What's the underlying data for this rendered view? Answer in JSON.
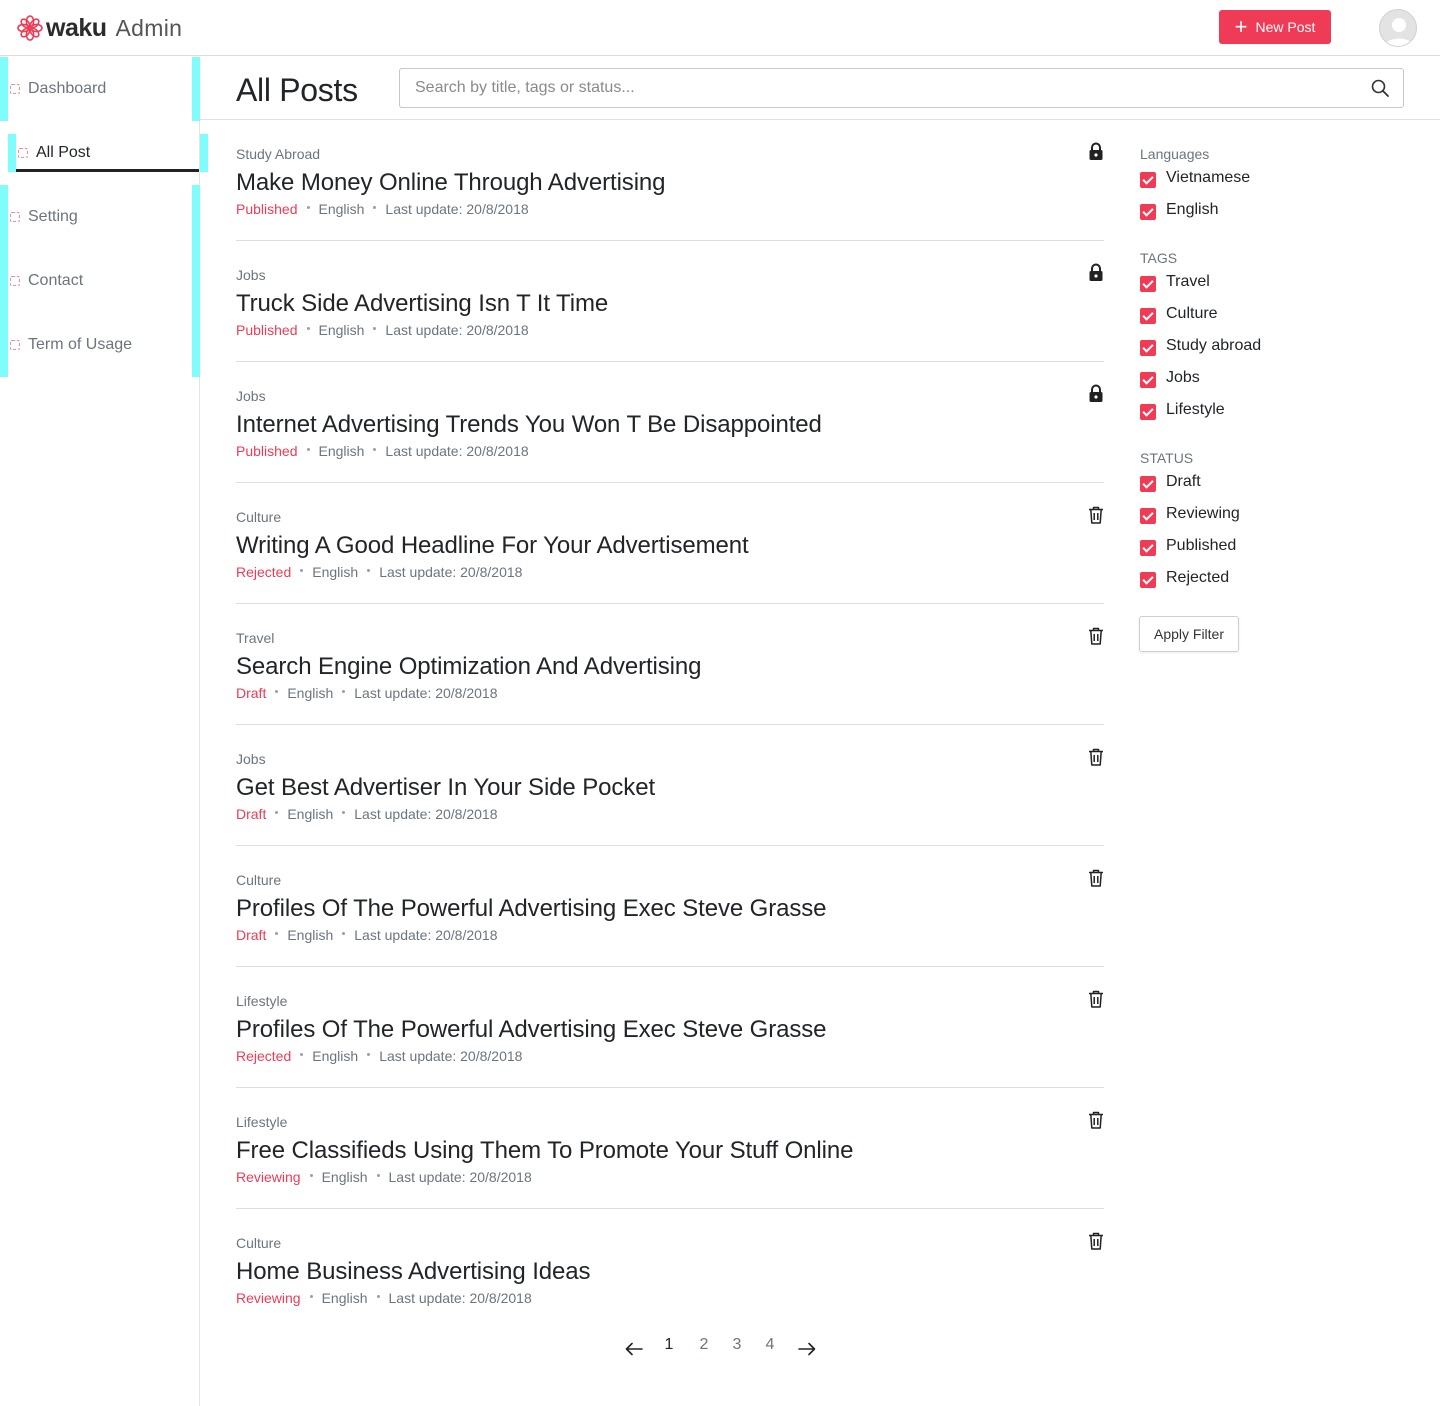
{
  "brand": {
    "name": "waku",
    "subtitle": "Admin"
  },
  "header": {
    "new_post_label": "New Post"
  },
  "sidebar": {
    "items": [
      {
        "label": "Dashboard"
      },
      {
        "label": "All Post"
      },
      {
        "label": "Setting"
      },
      {
        "label": "Contact"
      },
      {
        "label": "Term of Usage"
      }
    ]
  },
  "main": {
    "title": "All Posts",
    "search": {
      "placeholder": "Search by title, tags or status...",
      "value": ""
    }
  },
  "posts": [
    {
      "tag": "Study Abroad",
      "title": "Make Money Online Through Advertising",
      "status": "Published",
      "language": "English",
      "updated": "Last update: 20/8/2018",
      "action_icon": "lock-icon"
    },
    {
      "tag": "Jobs",
      "title": "Truck Side Advertising Isn T It Time",
      "status": "Published",
      "language": "English",
      "updated": "Last update: 20/8/2018",
      "action_icon": "lock-icon"
    },
    {
      "tag": "Jobs",
      "title": "Internet Advertising Trends You Won T Be Disappointed",
      "status": "Published",
      "language": "English",
      "updated": "Last update: 20/8/2018",
      "action_icon": "lock-icon"
    },
    {
      "tag": "Culture",
      "title": "Writing A Good Headline For Your Advertisement",
      "status": "Rejected",
      "language": "English",
      "updated": "Last update: 20/8/2018",
      "action_icon": "trash-icon"
    },
    {
      "tag": "Travel",
      "title": "Search Engine Optimization And Advertising",
      "status": "Draft",
      "language": "English",
      "updated": "Last update: 20/8/2018",
      "action_icon": "trash-icon"
    },
    {
      "tag": "Jobs",
      "title": "Get Best Advertiser In Your Side Pocket",
      "status": "Draft",
      "language": "English",
      "updated": "Last update: 20/8/2018",
      "action_icon": "trash-icon"
    },
    {
      "tag": "Culture",
      "title": "Profiles Of The Powerful Advertising Exec Steve Grasse",
      "status": "Draft",
      "language": "English",
      "updated": "Last update: 20/8/2018",
      "action_icon": "trash-icon"
    },
    {
      "tag": "Lifestyle",
      "title": "Profiles Of The Powerful Advertising Exec Steve Grasse",
      "status": "Rejected",
      "language": "English",
      "updated": "Last update: 20/8/2018",
      "action_icon": "trash-icon"
    },
    {
      "tag": "Lifestyle",
      "title": "Free Classifieds Using Them To Promote Your Stuff Online",
      "status": "Reviewing",
      "language": "English",
      "updated": "Last update: 20/8/2018",
      "action_icon": "trash-icon"
    },
    {
      "tag": "Culture",
      "title": "Home Business Advertising Ideas",
      "status": "Reviewing",
      "language": "English",
      "updated": "Last update: 20/8/2018",
      "action_icon": "trash-icon"
    }
  ],
  "filters": {
    "languages": {
      "heading": "Languages",
      "options": [
        {
          "label": "Vietnamese",
          "checked": true
        },
        {
          "label": "English",
          "checked": true
        }
      ]
    },
    "tags": {
      "heading": "TAGS",
      "options": [
        {
          "label": "Travel",
          "checked": true
        },
        {
          "label": "Culture",
          "checked": true
        },
        {
          "label": "Study abroad",
          "checked": true
        },
        {
          "label": "Jobs",
          "checked": true
        },
        {
          "label": "Lifestyle",
          "checked": true
        }
      ]
    },
    "status": {
      "heading": "STATUS",
      "options": [
        {
          "label": "Draft",
          "checked": true
        },
        {
          "label": "Reviewing",
          "checked": true
        },
        {
          "label": "Published",
          "checked": true
        },
        {
          "label": "Rejected",
          "checked": true
        }
      ]
    },
    "apply_label": "Apply Filter"
  },
  "pagination": {
    "pages": [
      "1",
      "2",
      "3",
      "4"
    ],
    "current": "1"
  },
  "colors": {
    "accent": "#ef3b55",
    "highlight_marker": "#7ffcfc",
    "text": "#212529",
    "muted": "#6c757d"
  }
}
